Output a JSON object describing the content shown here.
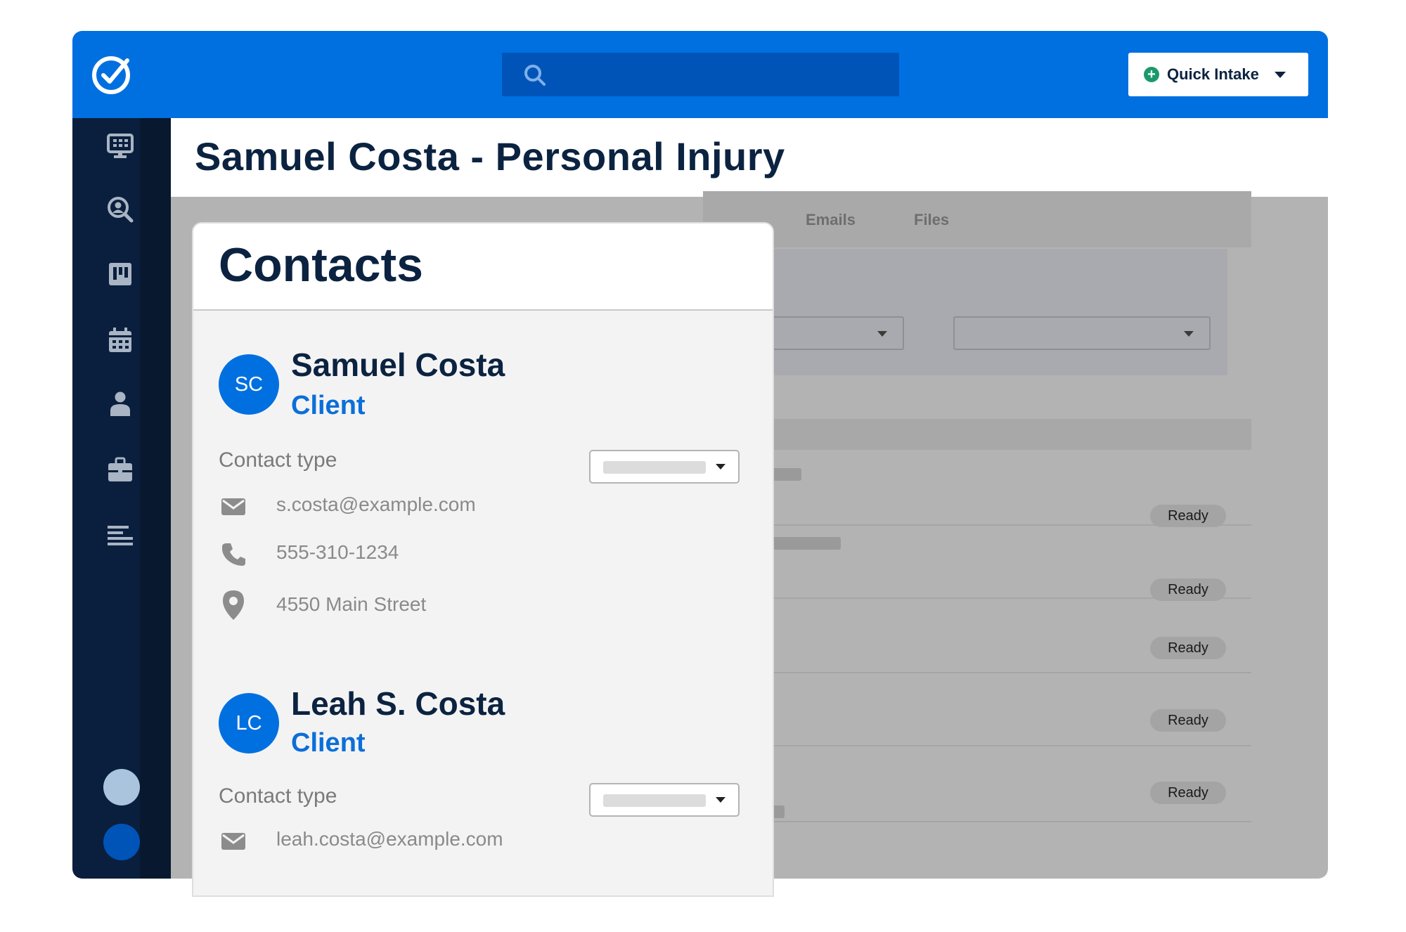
{
  "header": {
    "search_placeholder": "",
    "quick_intake_label": "Quick Intake"
  },
  "page": {
    "title": "Samuel Costa - Personal Injury"
  },
  "sidebar": {
    "icons": [
      "dashboard-icon",
      "search-person-icon",
      "board-icon",
      "calendar-icon",
      "person-icon",
      "briefcase-icon",
      "list-icon"
    ]
  },
  "background": {
    "tabs": [
      "Emails",
      "Files"
    ],
    "rows": [
      {
        "status": "Ready"
      },
      {
        "status": "Ready"
      },
      {
        "status": "Ready"
      },
      {
        "status": "Ready"
      },
      {
        "status": "Ready"
      }
    ]
  },
  "contacts": {
    "heading": "Contacts",
    "contact_type_label": "Contact type",
    "items": [
      {
        "initials": "SC",
        "name": "Samuel Costa",
        "role": "Client",
        "email": "s.costa@example.com",
        "phone": "555-310-1234",
        "address": "4550 Main Street"
      },
      {
        "initials": "LC",
        "name": "Leah S. Costa",
        "role": "Client",
        "email": "leah.costa@example.com"
      }
    ]
  },
  "colors": {
    "brand_blue": "#0070e0",
    "navy": "#0a1f3d",
    "client_blue": "#0b6fd8",
    "add_green": "#1a9a6a"
  }
}
